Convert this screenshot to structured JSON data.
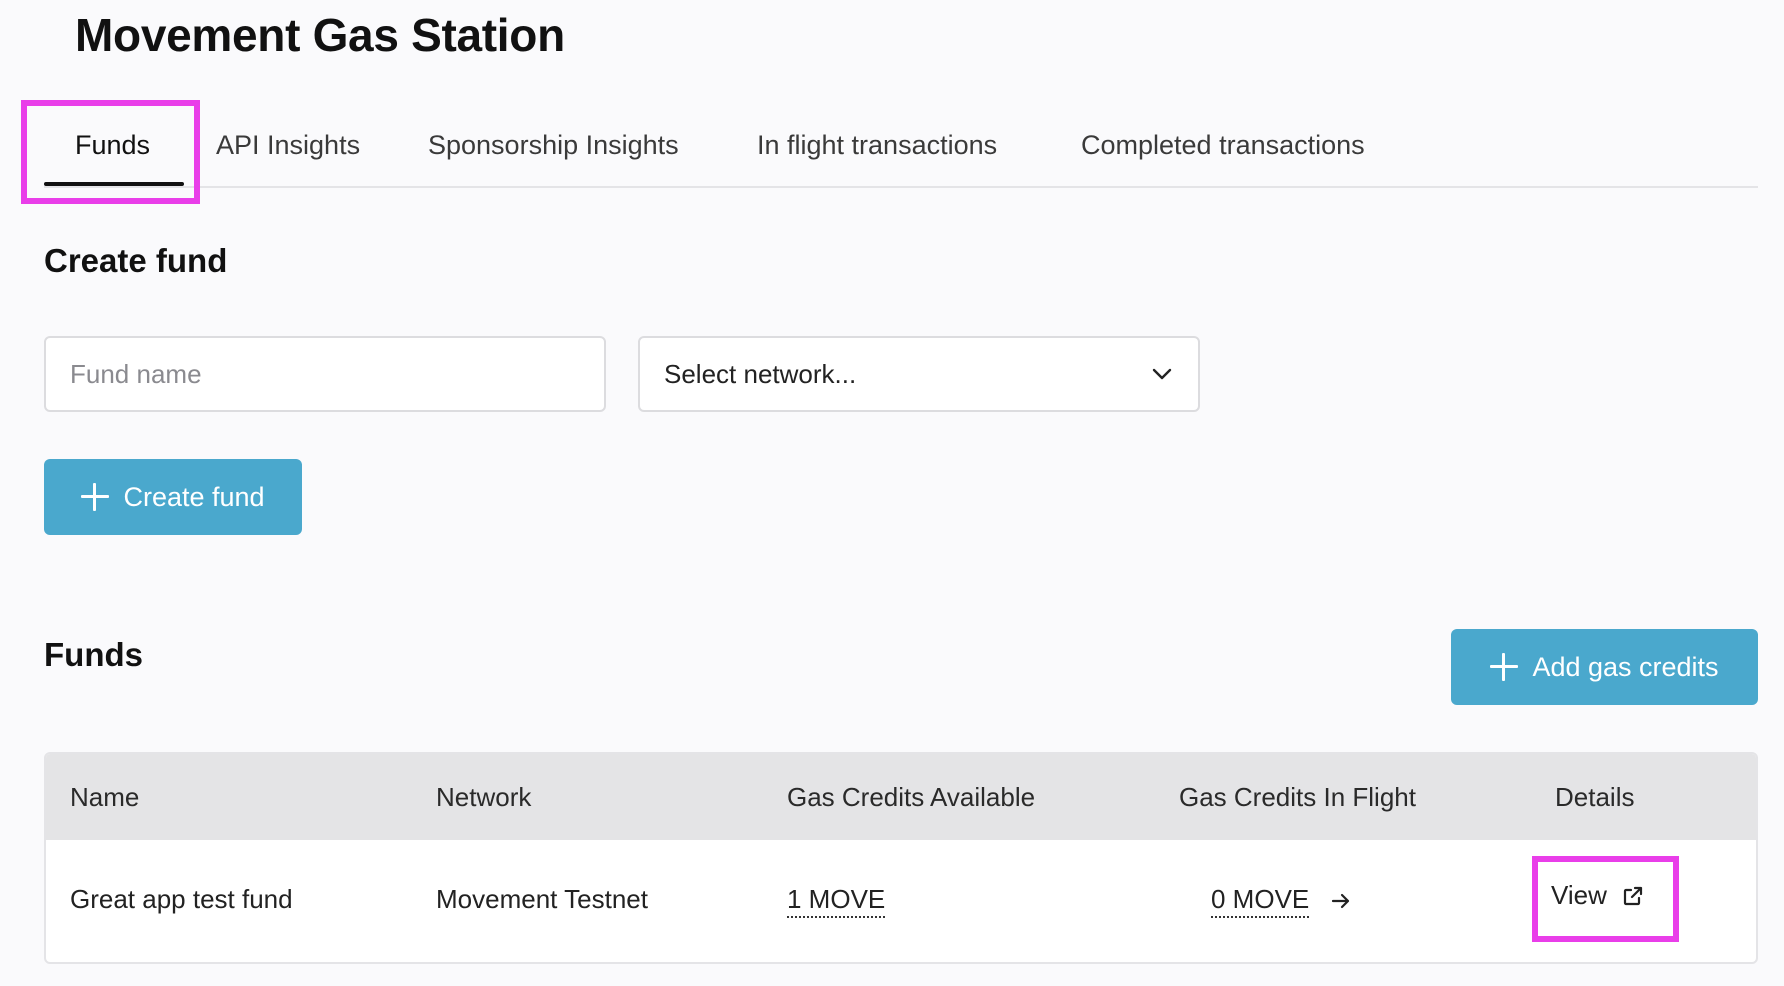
{
  "page": {
    "title": "Movement Gas Station"
  },
  "tabs": [
    {
      "label": "Funds",
      "active": true
    },
    {
      "label": "API Insights",
      "active": false
    },
    {
      "label": "Sponsorship Insights",
      "active": false
    },
    {
      "label": "In flight transactions",
      "active": false
    },
    {
      "label": "Completed transactions",
      "active": false
    }
  ],
  "create_fund": {
    "title": "Create fund",
    "fund_name_placeholder": "Fund name",
    "network_select": {
      "selected": "Select network...",
      "icon": "chevron-down-icon"
    },
    "button_label": "Create fund",
    "button_icon": "plus-icon"
  },
  "funds": {
    "title": "Funds",
    "add_credits_label": "Add gas credits",
    "add_credits_icon": "plus-icon",
    "columns": [
      "Name",
      "Network",
      "Gas Credits Available",
      "Gas Credits In Flight",
      "Details"
    ],
    "rows": [
      {
        "name": "Great app test fund",
        "network": "Movement Testnet",
        "available": "1 MOVE",
        "in_flight": "0 MOVE",
        "in_flight_icon": "arrow-right-icon",
        "details_label": "View",
        "details_icon": "external-link-icon"
      }
    ]
  },
  "colors": {
    "accent": "#4aa8cd",
    "highlight": "#e93ee9",
    "header_bg": "#e4e4e6",
    "page_bg": "#fafafc"
  }
}
